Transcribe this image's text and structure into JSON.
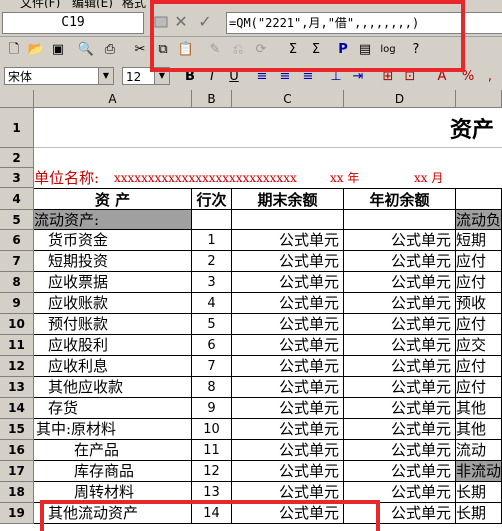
{
  "menu": [
    "文件(F)",
    "编辑(E)",
    "格式"
  ],
  "formula_bar": {
    "cell_ref": "C19",
    "cancel_symbol": "✕",
    "enter_symbol": "✓",
    "formula": "=QM(\"2221\",月,\"借\",,,,,,,,)"
  },
  "toolbar2": {
    "font_name": "宋体",
    "font_size": "12",
    "bold": "B",
    "italic": "I",
    "underline": "U"
  },
  "columns": [
    "A",
    "B",
    "C",
    "D"
  ],
  "title": "资产",
  "unit_line": {
    "label": "单位名称:",
    "company": "xxxxxxxxxxxxxxxxxxxxxxxxxxx",
    "year": "xx 年",
    "month": "xx 月"
  },
  "headers": {
    "item": "资    产",
    "line": "行次",
    "end": "期末余额",
    "begin": "年初余额"
  },
  "current_assets_label": "流动资产:",
  "rows": [
    {
      "row": "6",
      "name": "货币资金",
      "line": "1",
      "e": "公式单元",
      "b": "公式单元",
      "f": "短期"
    },
    {
      "row": "7",
      "name": "短期投资",
      "line": "2",
      "e": "公式单元",
      "b": "公式单元",
      "f": "应付"
    },
    {
      "row": "8",
      "name": "应收票据",
      "line": "3",
      "e": "公式单元",
      "b": "公式单元",
      "f": "应付"
    },
    {
      "row": "9",
      "name": "应收账款",
      "line": "4",
      "e": "公式单元",
      "b": "公式单元",
      "f": "预收"
    },
    {
      "row": "10",
      "name": "预付账款",
      "line": "5",
      "e": "公式单元",
      "b": "公式单元",
      "f": "应付"
    },
    {
      "row": "11",
      "name": "应收股利",
      "line": "6",
      "e": "公式单元",
      "b": "公式单元",
      "f": "应交"
    },
    {
      "row": "12",
      "name": "应收利息",
      "line": "7",
      "e": "公式单元",
      "b": "公式单元",
      "f": "应付"
    },
    {
      "row": "13",
      "name": "其他应收款",
      "line": "8",
      "e": "公式单元",
      "b": "公式单元",
      "f": "应付"
    },
    {
      "row": "14",
      "name": "存货",
      "line": "9",
      "e": "公式单元",
      "b": "公式单元",
      "f": "其他"
    },
    {
      "row": "15",
      "name": "其中:原材料",
      "line": "10",
      "e": "公式单元",
      "b": "公式单元",
      "f": "其他"
    },
    {
      "row": "16",
      "name": "在产品",
      "line": "11",
      "e": "公式单元",
      "b": "公式单元",
      "f": "流动"
    },
    {
      "row": "17",
      "name": "库存商品",
      "line": "12",
      "e": "公式单元",
      "b": "公式单元",
      "f": "非流动"
    },
    {
      "row": "18",
      "name": "周转材料",
      "line": "13",
      "e": "公式单元",
      "b": "公式单元",
      "f": "长期"
    },
    {
      "row": "19",
      "name": "其他流动资产",
      "line": "14",
      "e": "公式单元",
      "b": "公式单元",
      "f": "长期"
    }
  ],
  "col_e_header": "流动负",
  "row_labels": [
    "1",
    "2",
    "3",
    "4",
    "5"
  ],
  "colors": {
    "highlight": "#e8272a",
    "unit_text": "#cc0000",
    "section_fill": "#a0a0a0"
  }
}
